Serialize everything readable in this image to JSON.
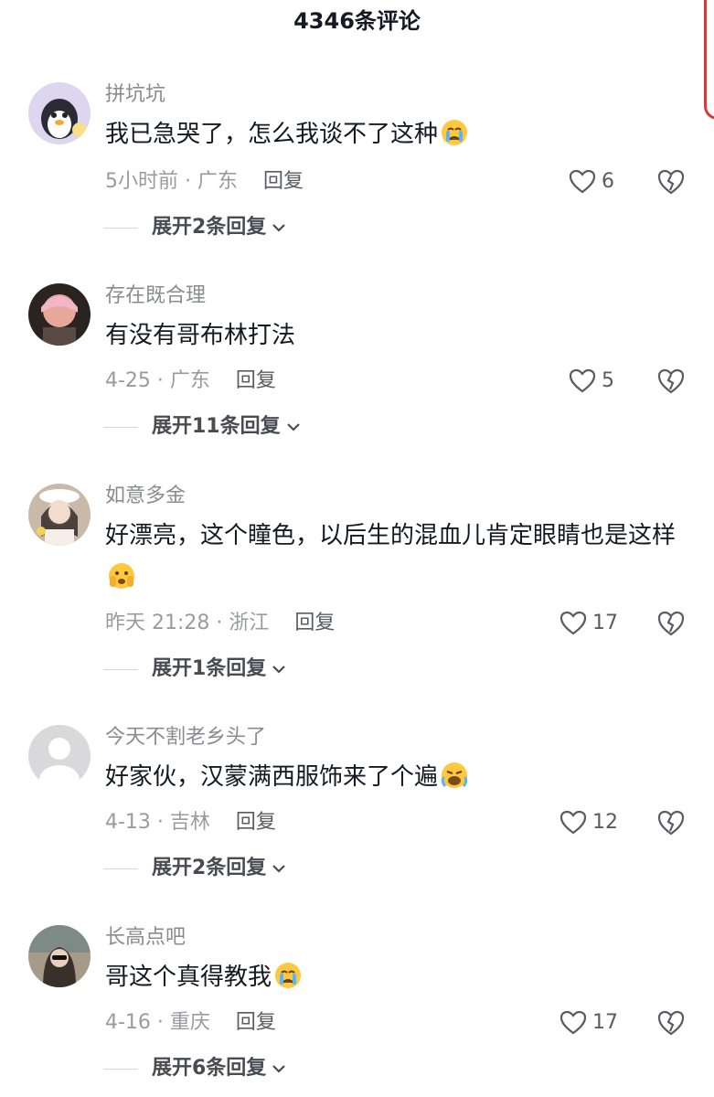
{
  "header": {
    "title": "4346条评论"
  },
  "comments": [
    {
      "username": "拼坑坑",
      "text": "我已急哭了，怎么我谈不了这种",
      "emoji": "crying-emoji",
      "time_location": "5小时前 · 广东",
      "reply_label": "回复",
      "likes": "6",
      "expand_label": "展开2条回复"
    },
    {
      "username": "存在既合理",
      "text": "有没有哥布林打法",
      "emoji": "",
      "time_location": "4-25 · 广东",
      "reply_label": "回复",
      "likes": "5",
      "expand_label": "展开11条回复"
    },
    {
      "username": "如意多金",
      "text": "好漂亮，这个瞳色，以后生的混血儿肯定眼睛也是这样",
      "emoji": "shocked-emoji",
      "time_location": "昨天 21:28 · 浙江",
      "reply_label": "回复",
      "likes": "17",
      "expand_label": "展开1条回复"
    },
    {
      "username": "今天不割老乡头了",
      "text": "好家伙，汉蒙满西服饰来了个遍",
      "emoji": "sobbing-emoji",
      "time_location": "4-13 · 吉林",
      "reply_label": "回复",
      "likes": "12",
      "expand_label": "展开2条回复"
    },
    {
      "username": "长高点吧",
      "text": "哥这个真得教我",
      "emoji": "crying-emoji",
      "time_location": "4-16 · 重庆",
      "reply_label": "回复",
      "likes": "17",
      "expand_label": "展开6条回复"
    }
  ],
  "colors": {
    "text": "#161823",
    "muted": "#9a9ba0",
    "accent": "#d63a3a",
    "emoji": "#ffc83d"
  }
}
